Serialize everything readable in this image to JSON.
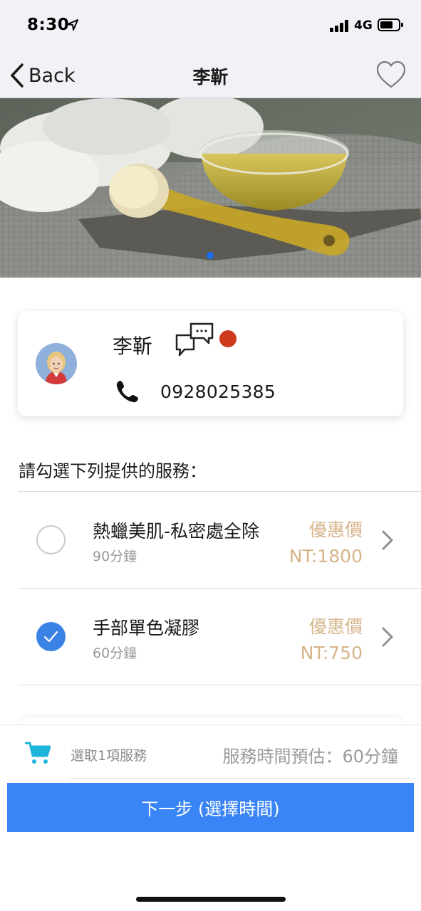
{
  "status_bar": {
    "time": "8:30",
    "network": "4G"
  },
  "nav": {
    "back_label": "Back",
    "title": "李靳"
  },
  "hero": {
    "page_indicator_active": 1
  },
  "profile": {
    "name": "李靳",
    "phone": "0928025385",
    "has_unread": true
  },
  "services_section": {
    "label": "請勾選下列提供的服務："
  },
  "services": [
    {
      "name": "熱蠟美肌-私密處全除",
      "duration": "90分鐘",
      "price_label": "優惠價",
      "price": "NT:1800",
      "selected": false
    },
    {
      "name": "手部單色凝膠",
      "duration": "60分鐘",
      "price_label": "優惠價",
      "price": "NT:750",
      "selected": true
    }
  ],
  "cart": {
    "selected_count": "選取1項服務",
    "estimated_time": "服務時間預估：60分鐘"
  },
  "next_button": {
    "label": "下一步 (選擇時間)"
  },
  "colors": {
    "primary": "#3a85f5",
    "price": "#d6b48a",
    "notify": "#cf3a1d",
    "cart_icon": "#1fb4d9"
  },
  "icons": [
    "location-arrow-icon",
    "signal-icon",
    "battery-icon",
    "back-chevron-icon",
    "heart-icon",
    "chat-bubbles-icon",
    "phone-icon",
    "checkmark-icon",
    "chevron-right-icon",
    "cart-icon"
  ]
}
